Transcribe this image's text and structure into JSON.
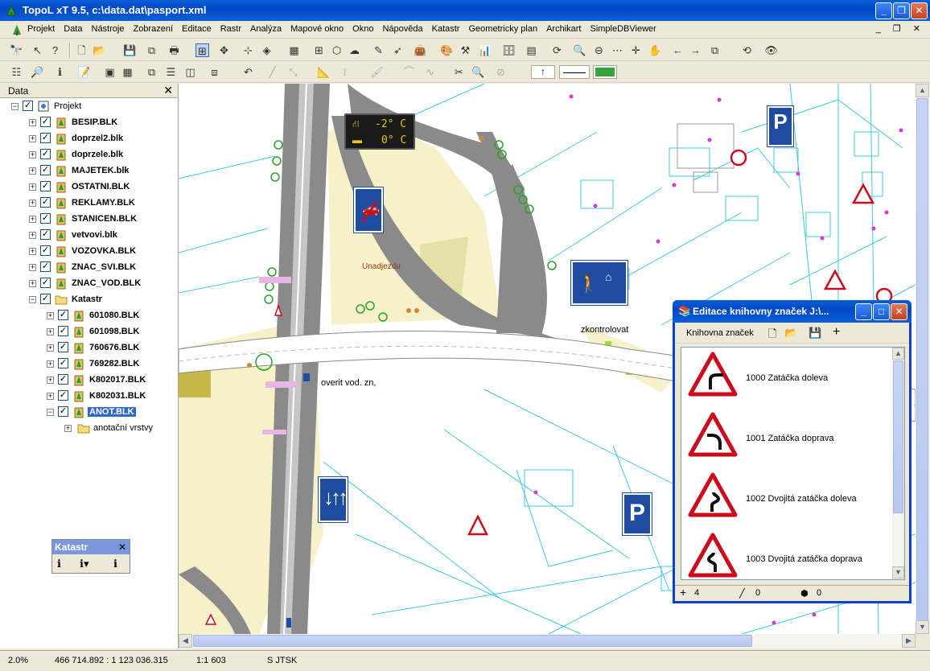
{
  "window": {
    "title": "TopoL xT 9.5, c:\\data.dat\\pasport.xml"
  },
  "menu": {
    "items": [
      "Projekt",
      "Data",
      "Nástroje",
      "Zobrazení",
      "Editace",
      "Rastr",
      "Analýza",
      "Mapové okno",
      "Okno",
      "Nápověda",
      "Katastr",
      "Geometricky plan",
      "Archikart",
      "SimpleDBViewer"
    ]
  },
  "data_panel": {
    "title": "Data",
    "tree": [
      {
        "label": "Projekt",
        "level": 0,
        "folder": "project"
      },
      {
        "label": "BESIP.BLK",
        "level": 1
      },
      {
        "label": "doprzel2.blk",
        "level": 1
      },
      {
        "label": "doprzele.blk",
        "level": 1
      },
      {
        "label": "MAJETEK.blk",
        "level": 1
      },
      {
        "label": "OSTATNI.BLK",
        "level": 1
      },
      {
        "label": "REKLAMY.BLK",
        "level": 1
      },
      {
        "label": "STANICEN.BLK",
        "level": 1
      },
      {
        "label": "vetvovi.blk",
        "level": 1
      },
      {
        "label": "VOZOVKA.BLK",
        "level": 1
      },
      {
        "label": "ZNAC_SVI.BLK",
        "level": 1
      },
      {
        "label": "ZNAC_VOD.BLK",
        "level": 1
      },
      {
        "label": "Katastr",
        "level": 1,
        "folder": "folder",
        "expanded": true
      },
      {
        "label": "601080.BLK",
        "level": 2
      },
      {
        "label": "601098.BLK",
        "level": 2
      },
      {
        "label": "760676.BLK",
        "level": 2
      },
      {
        "label": "769282.BLK",
        "level": 2
      },
      {
        "label": "K802017.BLK",
        "level": 2
      },
      {
        "label": "K802031.BLK",
        "level": 2
      },
      {
        "label": "ANOT.BLK",
        "level": 2,
        "selected": true,
        "expanded": true
      },
      {
        "label": "anotační vrstvy",
        "level": 3,
        "folder": "folder",
        "normal": true
      }
    ]
  },
  "katastr_toolbar": {
    "title": "Katastr"
  },
  "map": {
    "labels": {
      "temp1": "-2° C",
      "temp2": "0° C",
      "place": "Unadjezdu",
      "check": "zkontrolovat",
      "verify": "overit vod. zn,"
    }
  },
  "dialog": {
    "title": "Editace knihovny značek J:\\...",
    "menu_label": "Knihovna značek",
    "signs": [
      {
        "label": "1000 Zatáčka doleva",
        "kind": "left"
      },
      {
        "label": "1001 Zatáčka doprava",
        "kind": "right"
      },
      {
        "label": "1002 Dvojitá zatáčka doleva",
        "kind": "double-left"
      },
      {
        "label": "1003 Dvojitá zatáčka doprava",
        "kind": "double-right"
      }
    ],
    "status": {
      "points": "4",
      "lines": "0",
      "areas": "0"
    }
  },
  "statusbar": {
    "zoom": "2.0%",
    "coords": "466 714.892 : 1 123 036.315",
    "scale": "1:1 603",
    "crs": "S JTSK"
  },
  "colors": {
    "titlebar": "#0a5fd8",
    "sign_red": "#cc0c1c",
    "sign_blue": "#1e4ca0",
    "road_gray": "#8a8a8a",
    "map_cyan": "#3fc8e4"
  }
}
